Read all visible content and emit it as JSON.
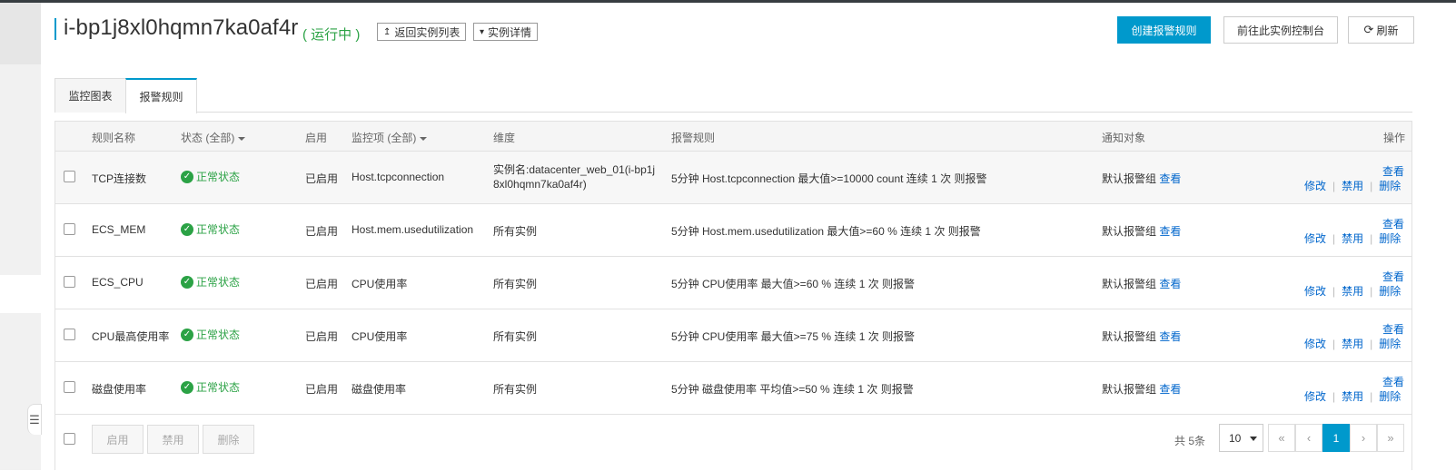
{
  "header": {
    "instance_id": "i-bp1j8xl0hqmn7ka0af4r",
    "status": "( 运行中 )",
    "back_label": "返回实例列表",
    "details_label": "实例详情",
    "create_rule_label": "创建报警规则",
    "console_label": "前往此实例控制台",
    "refresh_label": "刷新"
  },
  "tabs": [
    {
      "label": "监控图表",
      "active": false
    },
    {
      "label": "报警规则",
      "active": true
    }
  ],
  "table": {
    "columns": {
      "rule_name": "规则名称",
      "status": "状态 (全部)",
      "enabled": "启用",
      "metric": "监控项 (全部)",
      "dimension": "维度",
      "alarm_rule": "报警规则",
      "notify": "通知对象",
      "action": "操作"
    },
    "rows": [
      {
        "name": "TCP连接数",
        "status": "正常状态",
        "enabled": "已启用",
        "metric": "Host.tcpconnection",
        "dimension_line1": "实例名:datacenter_web_01(i-bp1j",
        "dimension_line2": "8xl0hqmn7ka0af4r)",
        "rule": "5分钟 Host.tcpconnection 最大值>=10000 count 连续 1 次 则报警",
        "notify": "默认报警组",
        "view": "查看"
      },
      {
        "name": "ECS_MEM",
        "status": "正常状态",
        "enabled": "已启用",
        "metric": "Host.mem.usedutilization",
        "dimension_line1": "所有实例",
        "dimension_line2": "",
        "rule": "5分钟 Host.mem.usedutilization 最大值>=60 % 连续 1 次 则报警",
        "notify": "默认报警组",
        "view": "查看"
      },
      {
        "name": "ECS_CPU",
        "status": "正常状态",
        "enabled": "已启用",
        "metric": "CPU使用率",
        "dimension_line1": "所有实例",
        "dimension_line2": "",
        "rule": "5分钟 CPU使用率 最大值>=60 % 连续 1 次 则报警",
        "notify": "默认报警组",
        "view": "查看"
      },
      {
        "name": "CPU最高使用率",
        "status": "正常状态",
        "enabled": "已启用",
        "metric": "CPU使用率",
        "dimension_line1": "所有实例",
        "dimension_line2": "",
        "rule": "5分钟 CPU使用率 最大值>=75 % 连续 1 次 则报警",
        "notify": "默认报警组",
        "view": "查看"
      },
      {
        "name": "磁盘使用率",
        "status": "正常状态",
        "enabled": "已启用",
        "metric": "磁盘使用率",
        "dimension_line1": "所有实例",
        "dimension_line2": "",
        "rule": "5分钟 磁盘使用率 平均值>=50 % 连续 1 次 则报警",
        "notify": "默认报警组",
        "view": "查看"
      }
    ],
    "actions": {
      "view": "查看",
      "edit": "修改",
      "disable": "禁用",
      "delete": "删除"
    }
  },
  "footer": {
    "enable_label": "启用",
    "disable_label": "禁用",
    "delete_label": "删除",
    "total": "共 5条",
    "page_size": "10",
    "first": "«",
    "prev": "‹",
    "current_page": "1",
    "next": "›",
    "last": "»"
  },
  "colors": {
    "accent": "#0099cc",
    "success": "#2ba245",
    "link": "#0066cc"
  }
}
